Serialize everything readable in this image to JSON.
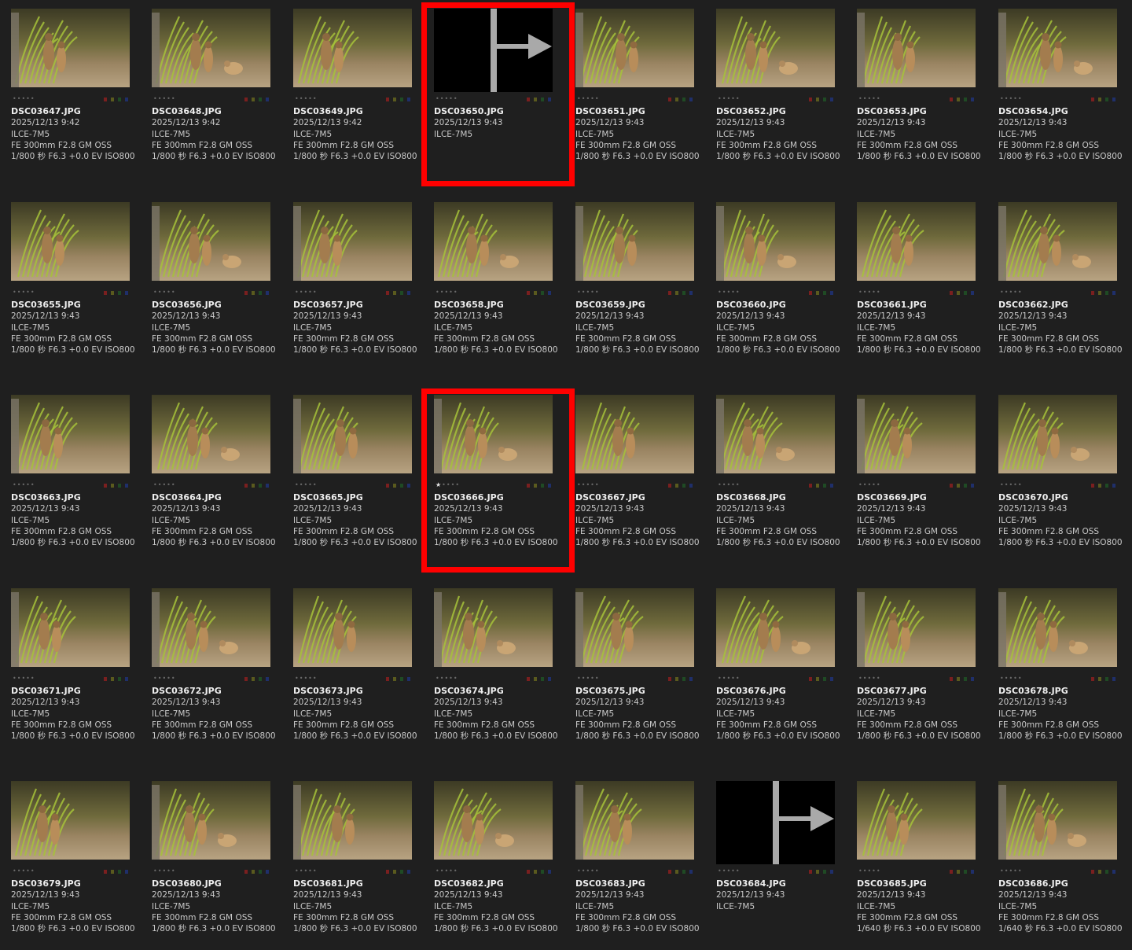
{
  "colors": {
    "background": "#1f1f1f",
    "highlight": "#ff0000",
    "label_red": "#7a1f1f",
    "label_olive": "#5a5a1e",
    "label_green": "#1f4a24",
    "label_blue": "#1f2f6a"
  },
  "marker_icon": "split-marker-arrow-icon",
  "items": [
    {
      "file": "DSC03647.JPG",
      "date": "2025/12/13 9:42",
      "body": "ILCE-7M5",
      "lens": "FE 300mm F2.8 GM OSS",
      "exposure": "1/800 秒 F6.3 +0.0 EV ISO800",
      "rating": 0,
      "kind": "photo",
      "highlighted": false
    },
    {
      "file": "DSC03648.JPG",
      "date": "2025/12/13 9:42",
      "body": "ILCE-7M5",
      "lens": "FE 300mm F2.8 GM OSS",
      "exposure": "1/800 秒 F6.3 +0.0 EV ISO800",
      "rating": 0,
      "kind": "photo",
      "highlighted": false
    },
    {
      "file": "DSC03649.JPG",
      "date": "2025/12/13 9:42",
      "body": "ILCE-7M5",
      "lens": "FE 300mm F2.8 GM OSS",
      "exposure": "1/800 秒 F6.3 +0.0 EV ISO800",
      "rating": 0,
      "kind": "photo",
      "highlighted": false
    },
    {
      "file": "DSC03650.JPG",
      "date": "2025/12/13 9:43",
      "body": "ILCE-7M5",
      "lens": "",
      "exposure": "",
      "rating": 0,
      "kind": "marker",
      "highlighted": true
    },
    {
      "file": "DSC03651.JPG",
      "date": "2025/12/13 9:43",
      "body": "ILCE-7M5",
      "lens": "FE 300mm F2.8 GM OSS",
      "exposure": "1/800 秒 F6.3 +0.0 EV ISO800",
      "rating": 0,
      "kind": "photo",
      "highlighted": false
    },
    {
      "file": "DSC03652.JPG",
      "date": "2025/12/13 9:43",
      "body": "ILCE-7M5",
      "lens": "FE 300mm F2.8 GM OSS",
      "exposure": "1/800 秒 F6.3 +0.0 EV ISO800",
      "rating": 0,
      "kind": "photo",
      "highlighted": false
    },
    {
      "file": "DSC03653.JPG",
      "date": "2025/12/13 9:43",
      "body": "ILCE-7M5",
      "lens": "FE 300mm F2.8 GM OSS",
      "exposure": "1/800 秒 F6.3 +0.0 EV ISO800",
      "rating": 0,
      "kind": "photo",
      "highlighted": false
    },
    {
      "file": "DSC03654.JPG",
      "date": "2025/12/13 9:43",
      "body": "ILCE-7M5",
      "lens": "FE 300mm F2.8 GM OSS",
      "exposure": "1/800 秒 F6.3 +0.0 EV ISO800",
      "rating": 0,
      "kind": "photo",
      "highlighted": false
    },
    {
      "file": "DSC03655.JPG",
      "date": "2025/12/13 9:43",
      "body": "ILCE-7M5",
      "lens": "FE 300mm F2.8 GM OSS",
      "exposure": "1/800 秒 F6.3 +0.0 EV ISO800",
      "rating": 0,
      "kind": "photo",
      "highlighted": false
    },
    {
      "file": "DSC03656.JPG",
      "date": "2025/12/13 9:43",
      "body": "ILCE-7M5",
      "lens": "FE 300mm F2.8 GM OSS",
      "exposure": "1/800 秒 F6.3 +0.0 EV ISO800",
      "rating": 0,
      "kind": "photo",
      "highlighted": false
    },
    {
      "file": "DSC03657.JPG",
      "date": "2025/12/13 9:43",
      "body": "ILCE-7M5",
      "lens": "FE 300mm F2.8 GM OSS",
      "exposure": "1/800 秒 F6.3 +0.0 EV ISO800",
      "rating": 0,
      "kind": "photo",
      "highlighted": false
    },
    {
      "file": "DSC03658.JPG",
      "date": "2025/12/13 9:43",
      "body": "ILCE-7M5",
      "lens": "FE 300mm F2.8 GM OSS",
      "exposure": "1/800 秒 F6.3 +0.0 EV ISO800",
      "rating": 0,
      "kind": "photo",
      "highlighted": false
    },
    {
      "file": "DSC03659.JPG",
      "date": "2025/12/13 9:43",
      "body": "ILCE-7M5",
      "lens": "FE 300mm F2.8 GM OSS",
      "exposure": "1/800 秒 F6.3 +0.0 EV ISO800",
      "rating": 0,
      "kind": "photo",
      "highlighted": false
    },
    {
      "file": "DSC03660.JPG",
      "date": "2025/12/13 9:43",
      "body": "ILCE-7M5",
      "lens": "FE 300mm F2.8 GM OSS",
      "exposure": "1/800 秒 F6.3 +0.0 EV ISO800",
      "rating": 0,
      "kind": "photo",
      "highlighted": false
    },
    {
      "file": "DSC03661.JPG",
      "date": "2025/12/13 9:43",
      "body": "ILCE-7M5",
      "lens": "FE 300mm F2.8 GM OSS",
      "exposure": "1/800 秒 F6.3 +0.0 EV ISO800",
      "rating": 0,
      "kind": "photo",
      "highlighted": false
    },
    {
      "file": "DSC03662.JPG",
      "date": "2025/12/13 9:43",
      "body": "ILCE-7M5",
      "lens": "FE 300mm F2.8 GM OSS",
      "exposure": "1/800 秒 F6.3 +0.0 EV ISO800",
      "rating": 0,
      "kind": "photo",
      "highlighted": false
    },
    {
      "file": "DSC03663.JPG",
      "date": "2025/12/13 9:43",
      "body": "ILCE-7M5",
      "lens": "FE 300mm F2.8 GM OSS",
      "exposure": "1/800 秒 F6.3 +0.0 EV ISO800",
      "rating": 0,
      "kind": "photo",
      "highlighted": false
    },
    {
      "file": "DSC03664.JPG",
      "date": "2025/12/13 9:43",
      "body": "ILCE-7M5",
      "lens": "FE 300mm F2.8 GM OSS",
      "exposure": "1/800 秒 F6.3 +0.0 EV ISO800",
      "rating": 0,
      "kind": "photo",
      "highlighted": false
    },
    {
      "file": "DSC03665.JPG",
      "date": "2025/12/13 9:43",
      "body": "ILCE-7M5",
      "lens": "FE 300mm F2.8 GM OSS",
      "exposure": "1/800 秒 F6.3 +0.0 EV ISO800",
      "rating": 0,
      "kind": "photo",
      "highlighted": false
    },
    {
      "file": "DSC03666.JPG",
      "date": "2025/12/13 9:43",
      "body": "ILCE-7M5",
      "lens": "FE 300mm F2.8 GM OSS",
      "exposure": "1/800 秒 F6.3 +0.0 EV ISO800",
      "rating": 1,
      "kind": "photo",
      "highlighted": true
    },
    {
      "file": "DSC03667.JPG",
      "date": "2025/12/13 9:43",
      "body": "ILCE-7M5",
      "lens": "FE 300mm F2.8 GM OSS",
      "exposure": "1/800 秒 F6.3 +0.0 EV ISO800",
      "rating": 0,
      "kind": "photo",
      "highlighted": false
    },
    {
      "file": "DSC03668.JPG",
      "date": "2025/12/13 9:43",
      "body": "ILCE-7M5",
      "lens": "FE 300mm F2.8 GM OSS",
      "exposure": "1/800 秒 F6.3 +0.0 EV ISO800",
      "rating": 0,
      "kind": "photo",
      "highlighted": false
    },
    {
      "file": "DSC03669.JPG",
      "date": "2025/12/13 9:43",
      "body": "ILCE-7M5",
      "lens": "FE 300mm F2.8 GM OSS",
      "exposure": "1/800 秒 F6.3 +0.0 EV ISO800",
      "rating": 0,
      "kind": "photo",
      "highlighted": false
    },
    {
      "file": "DSC03670.JPG",
      "date": "2025/12/13 9:43",
      "body": "ILCE-7M5",
      "lens": "FE 300mm F2.8 GM OSS",
      "exposure": "1/800 秒 F6.3 +0.0 EV ISO800",
      "rating": 0,
      "kind": "photo",
      "highlighted": false
    },
    {
      "file": "DSC03671.JPG",
      "date": "2025/12/13 9:43",
      "body": "ILCE-7M5",
      "lens": "FE 300mm F2.8 GM OSS",
      "exposure": "1/800 秒 F6.3 +0.0 EV ISO800",
      "rating": 0,
      "kind": "photo",
      "highlighted": false
    },
    {
      "file": "DSC03672.JPG",
      "date": "2025/12/13 9:43",
      "body": "ILCE-7M5",
      "lens": "FE 300mm F2.8 GM OSS",
      "exposure": "1/800 秒 F6.3 +0.0 EV ISO800",
      "rating": 0,
      "kind": "photo",
      "highlighted": false
    },
    {
      "file": "DSC03673.JPG",
      "date": "2025/12/13 9:43",
      "body": "ILCE-7M5",
      "lens": "FE 300mm F2.8 GM OSS",
      "exposure": "1/800 秒 F6.3 +0.0 EV ISO800",
      "rating": 0,
      "kind": "photo",
      "highlighted": false
    },
    {
      "file": "DSC03674.JPG",
      "date": "2025/12/13 9:43",
      "body": "ILCE-7M5",
      "lens": "FE 300mm F2.8 GM OSS",
      "exposure": "1/800 秒 F6.3 +0.0 EV ISO800",
      "rating": 0,
      "kind": "photo",
      "highlighted": false
    },
    {
      "file": "DSC03675.JPG",
      "date": "2025/12/13 9:43",
      "body": "ILCE-7M5",
      "lens": "FE 300mm F2.8 GM OSS",
      "exposure": "1/800 秒 F6.3 +0.0 EV ISO800",
      "rating": 0,
      "kind": "photo",
      "highlighted": false
    },
    {
      "file": "DSC03676.JPG",
      "date": "2025/12/13 9:43",
      "body": "ILCE-7M5",
      "lens": "FE 300mm F2.8 GM OSS",
      "exposure": "1/800 秒 F6.3 +0.0 EV ISO800",
      "rating": 0,
      "kind": "photo",
      "highlighted": false
    },
    {
      "file": "DSC03677.JPG",
      "date": "2025/12/13 9:43",
      "body": "ILCE-7M5",
      "lens": "FE 300mm F2.8 GM OSS",
      "exposure": "1/800 秒 F6.3 +0.0 EV ISO800",
      "rating": 0,
      "kind": "photo",
      "highlighted": false
    },
    {
      "file": "DSC03678.JPG",
      "date": "2025/12/13 9:43",
      "body": "ILCE-7M5",
      "lens": "FE 300mm F2.8 GM OSS",
      "exposure": "1/800 秒 F6.3 +0.0 EV ISO800",
      "rating": 0,
      "kind": "photo",
      "highlighted": false
    },
    {
      "file": "DSC03679.JPG",
      "date": "2025/12/13 9:43",
      "body": "ILCE-7M5",
      "lens": "FE 300mm F2.8 GM OSS",
      "exposure": "1/800 秒 F6.3 +0.0 EV ISO800",
      "rating": 0,
      "kind": "photo",
      "highlighted": false
    },
    {
      "file": "DSC03680.JPG",
      "date": "2025/12/13 9:43",
      "body": "ILCE-7M5",
      "lens": "FE 300mm F2.8 GM OSS",
      "exposure": "1/800 秒 F6.3 +0.0 EV ISO800",
      "rating": 0,
      "kind": "photo",
      "highlighted": false
    },
    {
      "file": "DSC03681.JPG",
      "date": "2025/12/13 9:43",
      "body": "ILCE-7M5",
      "lens": "FE 300mm F2.8 GM OSS",
      "exposure": "1/800 秒 F6.3 +0.0 EV ISO800",
      "rating": 0,
      "kind": "photo",
      "highlighted": false
    },
    {
      "file": "DSC03682.JPG",
      "date": "2025/12/13 9:43",
      "body": "ILCE-7M5",
      "lens": "FE 300mm F2.8 GM OSS",
      "exposure": "1/800 秒 F6.3 +0.0 EV ISO800",
      "rating": 0,
      "kind": "photo",
      "highlighted": false
    },
    {
      "file": "DSC03683.JPG",
      "date": "2025/12/13 9:43",
      "body": "ILCE-7M5",
      "lens": "FE 300mm F2.8 GM OSS",
      "exposure": "1/800 秒 F6.3 +0.0 EV ISO800",
      "rating": 0,
      "kind": "photo",
      "highlighted": false
    },
    {
      "file": "DSC03684.JPG",
      "date": "2025/12/13 9:43",
      "body": "ILCE-7M5",
      "lens": "",
      "exposure": "",
      "rating": 0,
      "kind": "marker",
      "highlighted": false
    },
    {
      "file": "DSC03685.JPG",
      "date": "2025/12/13 9:43",
      "body": "ILCE-7M5",
      "lens": "FE 300mm F2.8 GM OSS",
      "exposure": "1/640 秒 F6.3 +0.0 EV ISO800",
      "rating": 0,
      "kind": "photo",
      "highlighted": false
    },
    {
      "file": "DSC03686.JPG",
      "date": "2025/12/13 9:43",
      "body": "ILCE-7M5",
      "lens": "FE 300mm F2.8 GM OSS",
      "exposure": "1/640 秒 F6.3 +0.0 EV ISO800",
      "rating": 0,
      "kind": "photo",
      "highlighted": false
    }
  ]
}
